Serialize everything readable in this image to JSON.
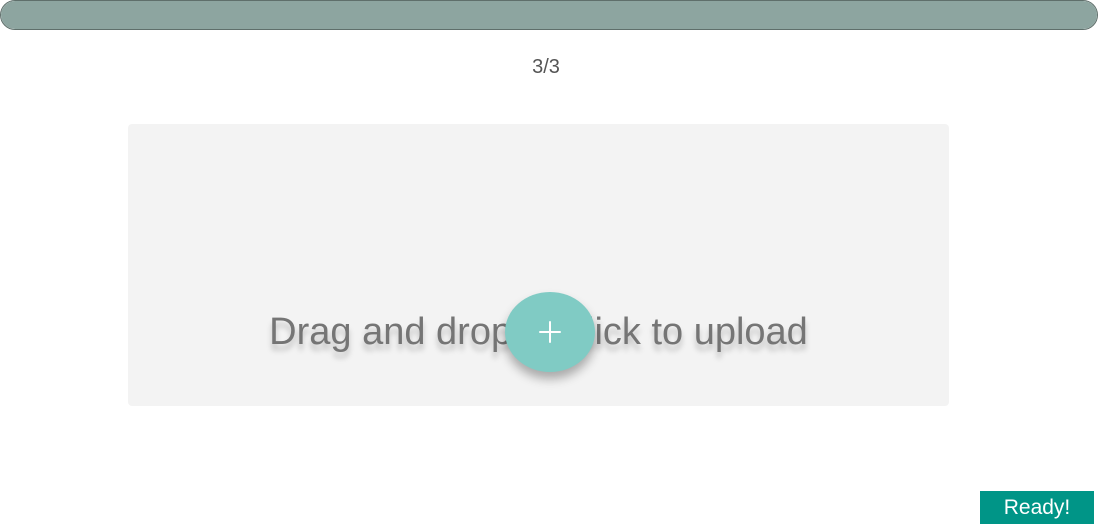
{
  "progress": {
    "current_step": 3,
    "total_steps": 3,
    "fraction_complete": 1.0,
    "fill_color": "#8da5a0"
  },
  "step_counter": "3/3",
  "dropzone": {
    "prompt": "Drag and drop or click to upload",
    "add_button_icon": "plus-icon",
    "add_button_color": "#80cbc4"
  },
  "status": {
    "label": "Ready!",
    "color": "#009587"
  }
}
